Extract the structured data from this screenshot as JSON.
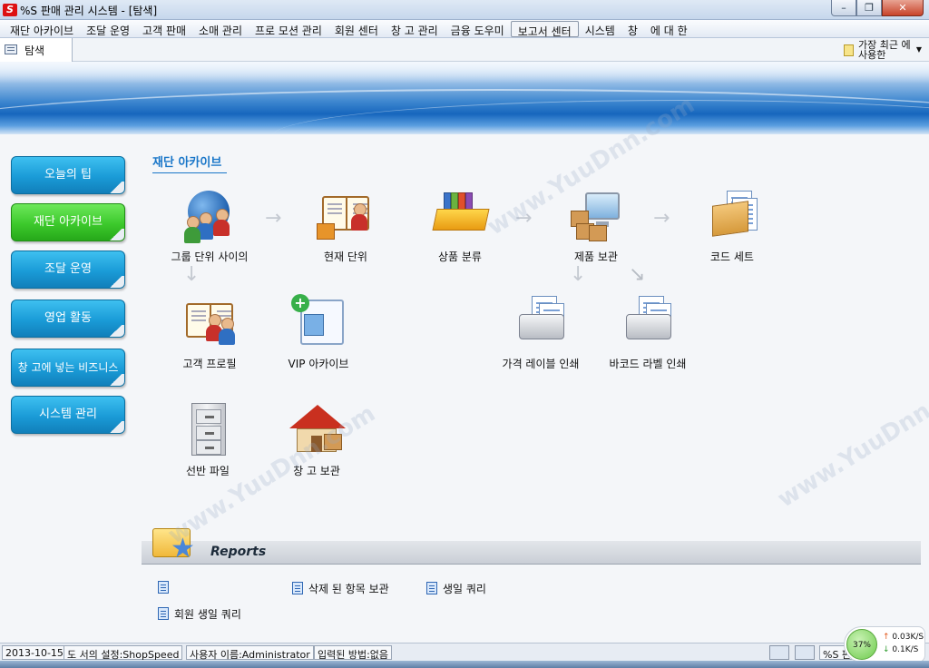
{
  "window": {
    "app_icon_text": "S",
    "title": "%S 판매 관리 시스템 - [탐색]",
    "buttons": [
      "minimize",
      "maximize",
      "close"
    ]
  },
  "menu": {
    "items": [
      "재단 아카이브",
      "조달 운영",
      "고객 판매",
      "소매 관리",
      "프로 모션 관리",
      "회원 센터",
      "창 고 관리",
      "금융 도우미",
      "보고서 센터",
      "시스템",
      "창",
      "에 대 한"
    ],
    "active_index": 8
  },
  "tabs": [
    {
      "label": "탐색"
    }
  ],
  "recent": {
    "label": "가장 최근 에 사용한"
  },
  "sidebar": {
    "items": [
      {
        "label": "오늘의 팁"
      },
      {
        "label": "재단 아카이브"
      },
      {
        "label": "조달 운영"
      },
      {
        "label": "영업 활동"
      },
      {
        "label": "창 고에 넣는 비즈니스"
      },
      {
        "label": "시스템 관리"
      }
    ],
    "active_index": 1
  },
  "section": {
    "title": "재단 아카이브"
  },
  "nodes": {
    "group_unit": "그룹 단위 사이의",
    "current_unit": "현재 단위",
    "product_category": "상품 분류",
    "product_storage": "제품 보관",
    "code_set": "코드 세트",
    "customer_profile": "고객 프로필",
    "vip_archive": "VIP 아카이브",
    "price_label_print": "가격 레이블 인쇄",
    "barcode_label_print": "바코드 라벨 인쇄",
    "shelf_file": "선반 파일",
    "warehouse_storage": "창 고 보관"
  },
  "reports": {
    "title": "Reports",
    "links": [
      "",
      "삭제 된 항목 보관",
      "생일 쿼리",
      "회원 생일 쿼리"
    ]
  },
  "status": {
    "date": "2013-10-15",
    "store_setting": "도 서의 설정:ShopSpeed",
    "username": "사용자 이름:Administrator",
    "input_method": "입력된 방법:없음",
    "right_text": "%S 판"
  },
  "network": {
    "percent": "37%",
    "upload": "0.03K/S",
    "download": "0.1K/S"
  },
  "watermarks": [
    "www.YuuDnn.com",
    "www.YuuDnn.com",
    "www.YuuDnn.com"
  ],
  "colors": {
    "sidebar_blue": "#1a9bd7",
    "sidebar_green": "#3cc92c",
    "section_title": "#1976c8",
    "banner_blue": "#1666bd"
  }
}
